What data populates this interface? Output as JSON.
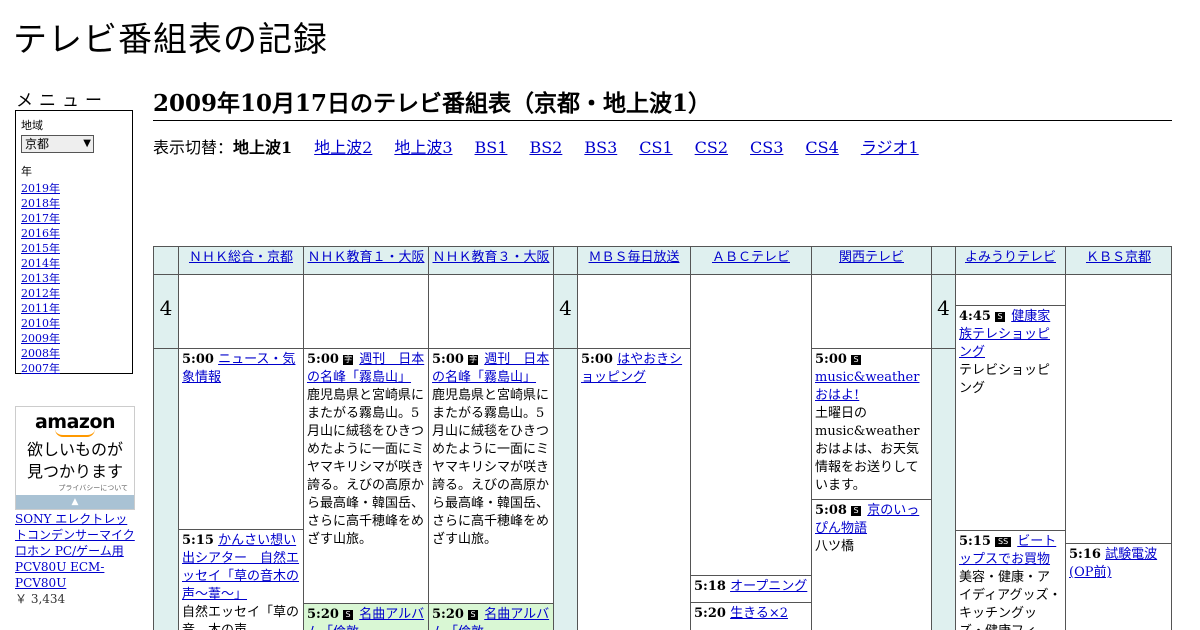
{
  "site": {
    "title": "テレビ番組表の記録"
  },
  "sidebar": {
    "menu_heading": "メニュー",
    "region_label": "地域",
    "region_value": "京都",
    "year_label": "年",
    "years": [
      "2019年",
      "2018年",
      "2017年",
      "2016年",
      "2015年",
      "2014年",
      "2013年",
      "2012年",
      "2011年",
      "2010年",
      "2009年",
      "2008年",
      "2007年"
    ]
  },
  "ad": {
    "logo": "amazon",
    "tagline_1": "欲しいものが",
    "tagline_2": "見つかります",
    "privacy": "プライバシーについて",
    "product_name": "SONY エレクトレットコンデンサーマイクロホン PC/ゲーム用 PCV80U ECM-PCV80U",
    "product_price": "￥ 3,434"
  },
  "main": {
    "heading": "2009年10月17日のテレビ番組表（京都・地上波1）",
    "switch_label": "表示切替：",
    "switch_current": "地上波1",
    "switch_links": [
      "地上波2",
      "地上波3",
      "BS1",
      "BS2",
      "BS3",
      "CS1",
      "CS2",
      "CS3",
      "CS4",
      "ラジオ1"
    ]
  },
  "grid": {
    "hour": "4",
    "channels": [
      "ＮＨＫ総合・京都",
      "ＮＨＫ教育１・大阪",
      "ＮＨＫ教育３・大阪",
      "ＭＢＳ毎日放送",
      "ＡＢＣテレビ",
      "関西テレビ",
      "よみうりテレビ",
      "ＫＢＳ京都"
    ],
    "programs": {
      "nhk_g_1": {
        "time": "5:00",
        "title": "ニュース・気象情報"
      },
      "nhk_g_2": {
        "time": "5:15",
        "title": "かんさい想い出シアター　自然エッセイ「草の音木の声～葦～」",
        "desc": "自然エッセイ「草の音　木の声"
      },
      "nhk_e1_1": {
        "time": "5:00",
        "icon": "字",
        "title": "週刊　日本の名峰「霧島山」",
        "desc": "鹿児島県と宮崎県にまたがる霧島山。5月山に絨毯をひきつめたように一面にミヤマキリシマが咲き誇る。えびの高原から最高峰・韓国岳、さらに高千穂峰をめざす山旅。"
      },
      "nhk_e1_2": {
        "time": "5:20",
        "icon": "S",
        "title": "名曲アルバム「倫敦"
      },
      "nhk_e3_1": {
        "time": "5:00",
        "icon": "字",
        "title": "週刊　日本の名峰「霧島山」",
        "desc": "鹿児島県と宮崎県にまたがる霧島山。5月山に絨毯をひきつめたように一面にミヤマキリシマが咲き誇る。えびの高原から最高峰・韓国岳、さらに高千穂峰をめざす山旅。"
      },
      "nhk_e3_2": {
        "time": "5:20",
        "icon": "S",
        "title": "名曲アルバム「倫敦"
      },
      "mbs_1": {
        "time": "5:00",
        "title": "はやおきショッピング"
      },
      "abc_1": {
        "time": "5:18",
        "title": "オープニング"
      },
      "abc_2": {
        "time": "5:20",
        "title": "生きる×2"
      },
      "ktv_1": {
        "time": "5:00",
        "icon": "S",
        "title": "music&weatherおはよ!",
        "desc": "土曜日のmusic&weatherおはよは、お天気情報をお送りしています。"
      },
      "ktv_2": {
        "time": "5:08",
        "icon": "S",
        "title": "京のいっぴん物語",
        "desc": "八ツ橋"
      },
      "ytv_1": {
        "time": "4:45",
        "icon": "S",
        "title": "健康家族テレショッピング",
        "desc": "テレビショッピング"
      },
      "ytv_2": {
        "time": "5:15",
        "icon": "SS",
        "title": "ビートップスでお買物",
        "desc": "美容・健康・アイディアグッズ・キッチングッズ・健康フィ"
      },
      "kbs_1": {
        "time": "5:16",
        "title": "試験電波(OP前)"
      }
    }
  }
}
